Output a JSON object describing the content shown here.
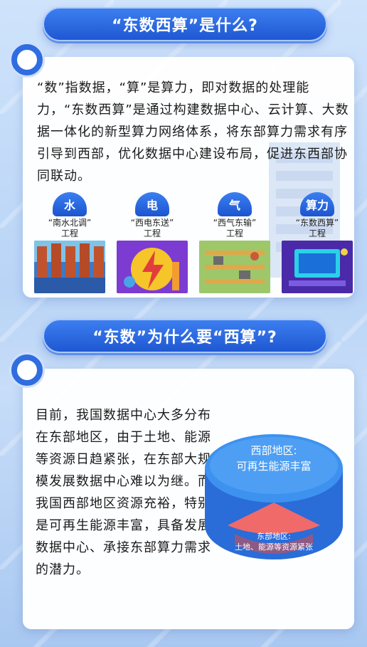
{
  "section1": {
    "title": "“东数西算”是什么?",
    "body": "“数”指数据，“算”是算力，即对数据的处理能力，“东数西算”是通过构建数据中心、云计算、大数据一体化的新型算力网络体系，将东部算力需求有序引导到西部，优化数据中心建设布局，促进东西部协同联动。",
    "tiles": [
      {
        "badge": "水",
        "line1": "“南水北调”",
        "line2": "工程"
      },
      {
        "badge": "电",
        "line1": "“西电东送”",
        "line2": "工程"
      },
      {
        "badge": "气",
        "line1": "“西气东输”",
        "line2": "工程"
      },
      {
        "badge": "算力",
        "line1": "“东数西算”",
        "line2": "工程"
      }
    ]
  },
  "section2": {
    "title": "“东数”为什么要“西算”?",
    "body": "目前，我国数据中心大多分布在东部地区，由于土地、能源等资源日趋紧张，在东部大规模发展数据中心难以为继。而我国西部地区资源充裕，特别是可再生能源丰富，具备发展数据中心、承接东部算力需求的潜力。",
    "west_line1": "西部地区:",
    "west_line2": "可再生能源丰富",
    "east_line1": "东部地区:",
    "east_line2": "土地、能源等资源紧张"
  },
  "colors": {
    "accent": "#2f6de0",
    "west": "#2f7ae6",
    "east": "#f06a6a"
  }
}
